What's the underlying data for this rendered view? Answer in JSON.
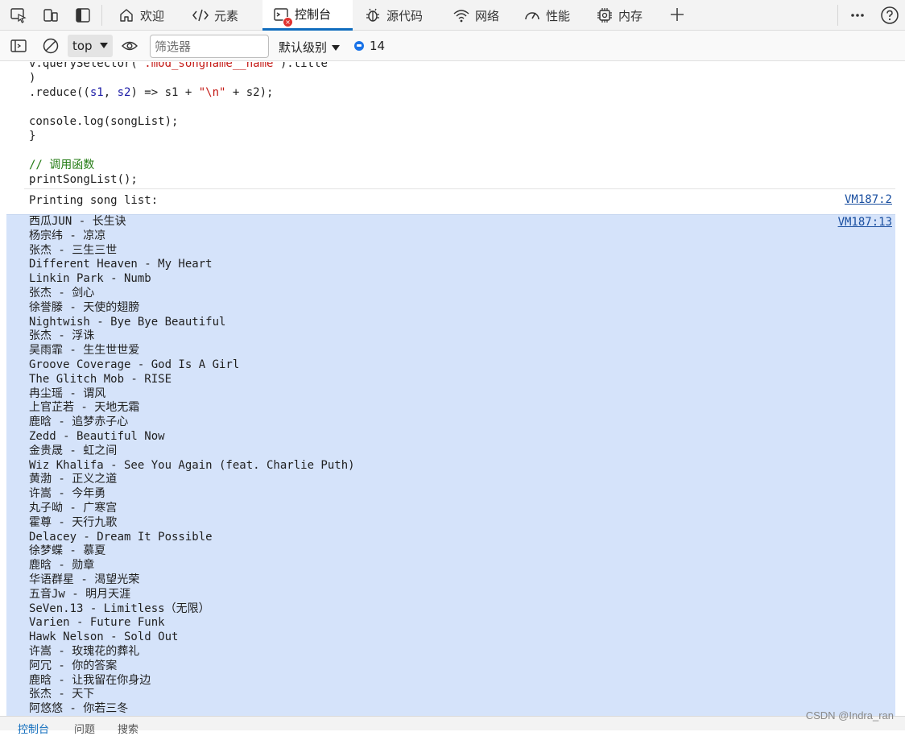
{
  "tabs": [
    {
      "label": "欢迎",
      "icon": "home-icon"
    },
    {
      "label": "元素",
      "icon": "code-tag-icon"
    },
    {
      "label": "控制台",
      "icon": "console-icon",
      "active": true
    },
    {
      "label": "源代码",
      "icon": "bug-icon"
    },
    {
      "label": "网络",
      "icon": "wifi-icon"
    },
    {
      "label": "性能",
      "icon": "gauge-icon"
    },
    {
      "label": "内存",
      "icon": "chip-icon"
    }
  ],
  "toolbar": {
    "context": "top",
    "filter_placeholder": "筛选器",
    "level": "默认级别",
    "issues_count": "14"
  },
  "code_lines": {
    "l1a": "v.querySelector(",
    "l1b": "'.mod_songname__name'",
    "l1c": ").title",
    "l2": ")",
    "l3a": ".reduce((",
    "l3b": "s1",
    "l3c": ", ",
    "l3d": "s2",
    "l3e": ") => s1 + ",
    "l3f": "\"\\n\"",
    "l3g": " + s2);",
    "l5": "console.log(songList);",
    "l6": "}",
    "l8": "// 调用函数",
    "l9": "printSongList();"
  },
  "messages": {
    "printing": "Printing song list:",
    "printing_source": "VM187:2",
    "songs_source": "VM187:13"
  },
  "songs": [
    "西瓜JUN - 长生诀",
    "杨宗纬 - 凉凉",
    "张杰 - 三生三世",
    "Different Heaven - My Heart",
    "Linkin Park - Numb",
    "张杰 - 剑心",
    "徐誉滕 - 天使的翅膀",
    "Nightwish - Bye Bye Beautiful",
    "张杰 - 浮诛",
    "吴雨霏 - 生生世世爱",
    "Groove Coverage - God Is A Girl",
    "The Glitch Mob - RISE",
    "冉尘瑶 - 谓风",
    "上官芷若 - 天地无霜",
    "鹿晗 - 追梦赤子心",
    "Zedd - Beautiful Now",
    "金贵晟 - 虹之间",
    "Wiz Khalifa - See You Again (feat. Charlie Puth)",
    "黄渤 - 正义之道",
    "许嵩 - 今年勇",
    "丸子呦 - 广寒宫",
    "霍尊 - 天行九歌",
    "Delacey - Dream It Possible",
    "徐梦蝶 - 慕夏",
    "鹿晗 - 勋章",
    "华语群星 - 渴望光荣",
    "五音Jw - 明月天涯",
    "SeVen.13 - Limitless（无限）",
    "Varien - Future Funk",
    "Hawk Nelson - Sold Out",
    "许嵩 - 玫瑰花的葬礼",
    "阿冗 - 你的答案",
    "鹿晗 - 让我留在你身边",
    "张杰 - 天下",
    "阿悠悠 - 你若三冬"
  ],
  "drawer": [
    "控制台",
    "问题",
    "搜索"
  ],
  "watermark": "CSDN @Indra_ran",
  "colors": {
    "accent": "#0f6cbd",
    "selection": "#d5e3fa",
    "string": "#c41a16",
    "comment": "#237b13",
    "link": "#1a4fa0"
  }
}
